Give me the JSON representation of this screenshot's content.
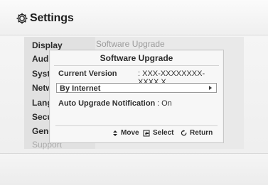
{
  "app": {
    "title": "Settings"
  },
  "sidebar": {
    "items": [
      {
        "label": "Display"
      },
      {
        "label": "Audio"
      },
      {
        "label": "System"
      },
      {
        "label": "Network"
      },
      {
        "label": "Language"
      },
      {
        "label": "Security"
      },
      {
        "label": "General"
      },
      {
        "label": "Support"
      }
    ]
  },
  "main": {
    "title": "Software Upgrade"
  },
  "dialog": {
    "title": "Software Upgrade",
    "current_version_label": "Current Version",
    "current_version_value": ": XXX-XXXXXXXX-XXXX.X",
    "selected_option": "By Internet",
    "auto_upgrade_label": "Auto Upgrade Notification",
    "auto_upgrade_value": ": On",
    "hints": {
      "move": "Move",
      "select": "Select",
      "return": "Return"
    }
  }
}
